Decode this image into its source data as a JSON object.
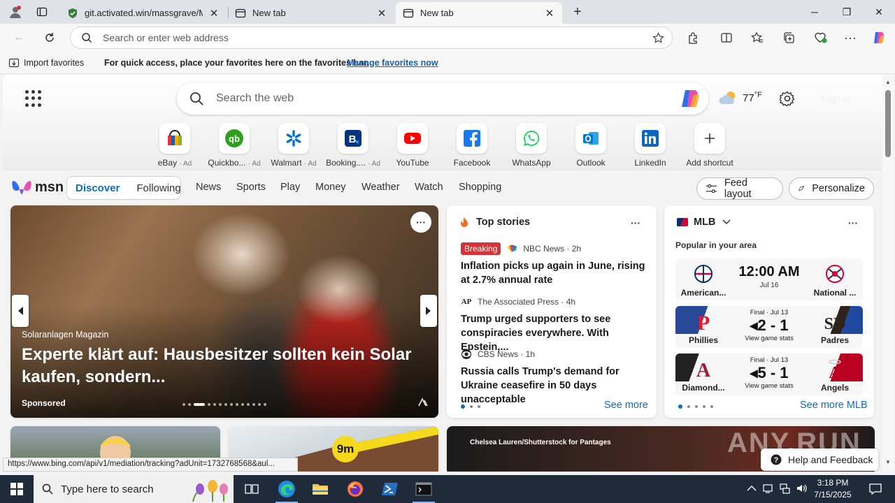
{
  "browser": {
    "tabs": [
      {
        "title": "git.activated.win/massgrave/Micr",
        "active": false
      },
      {
        "title": "New tab",
        "active": false
      },
      {
        "title": "New tab",
        "active": true
      }
    ],
    "address_placeholder": "Search or enter web address",
    "favorites_bar": {
      "import_label": "Import favorites",
      "message": "For quick access, place your favorites here on the favorites bar.",
      "manage_link": "Manage favorites now"
    },
    "status_url": "https://www.bing.com/api/v1/mediation/tracking?adUnit=1732768568&aul..."
  },
  "newtab": {
    "search_placeholder": "Search the web",
    "weather": {
      "temp": "77",
      "unit": "°F"
    },
    "signin_label": "Sign in",
    "shortcuts": [
      {
        "label": "eBay",
        "ad": "· Ad",
        "icon": "ebay-icon",
        "color": "#e53238"
      },
      {
        "label": "Quickbo...",
        "ad": "· Ad",
        "icon": "quickbooks-icon",
        "color": "#2ca01c"
      },
      {
        "label": "Walmart",
        "ad": "· Ad",
        "icon": "walmart-icon",
        "color": "#0071ce"
      },
      {
        "label": "Booking....",
        "ad": "· Ad",
        "icon": "booking-icon",
        "color": "#003580"
      },
      {
        "label": "YouTube",
        "ad": "",
        "icon": "youtube-icon",
        "color": "#ff0000"
      },
      {
        "label": "Facebook",
        "ad": "",
        "icon": "facebook-icon",
        "color": "#1877f2"
      },
      {
        "label": "WhatsApp",
        "ad": "",
        "icon": "whatsapp-icon",
        "color": "#25d366"
      },
      {
        "label": "Outlook",
        "ad": "",
        "icon": "outlook-icon",
        "color": "#0078d4"
      },
      {
        "label": "LinkedIn",
        "ad": "",
        "icon": "linkedin-icon",
        "color": "#0a66c2"
      },
      {
        "label": "Add shortcut",
        "ad": "",
        "icon": "plus-icon",
        "color": "#333333"
      }
    ]
  },
  "msn": {
    "logo_text": "msn",
    "feed_tabs": [
      "Discover",
      "Following"
    ],
    "nav": [
      "News",
      "Sports",
      "Play",
      "Money",
      "Weather",
      "Watch",
      "Shopping"
    ],
    "feed_layout_label": "Feed layout",
    "personalize_label": "Personalize",
    "hero": {
      "source": "Solaranlagen Magazin",
      "title": "Experte klärt auf: Hausbesitzer sollten kein Solar kaufen, sondern...",
      "sponsored": "Sponsored"
    },
    "top_stories": {
      "title": "Top stories",
      "items": [
        {
          "badge": "Breaking",
          "source": "NBC News · 2h",
          "headline": "Inflation picks up again in June, rising at 2.7% annual rate"
        },
        {
          "badge": "",
          "source": "The Associated Press · 4h",
          "headline": "Trump urged supporters to see conspiracies everywhere. With Epstein,..."
        },
        {
          "badge": "",
          "source": "CBS News · 1h",
          "headline": "Russia calls Trump's demand for Ukraine ceasefire in 50 days unacceptable"
        }
      ],
      "see_more": "See more"
    },
    "mlb": {
      "title": "MLB",
      "subtitle": "Popular in your area",
      "games": [
        {
          "home": "American...",
          "away": "National ...",
          "time": "12:00 AM",
          "date": "Jul 16",
          "status": "",
          "score": "",
          "stats": ""
        },
        {
          "home": "Phillies",
          "away": "Padres",
          "time": "",
          "date": "",
          "status": "Final · Jul 13",
          "score": "2 - 1",
          "stats": "View game stats"
        },
        {
          "home": "Diamond...",
          "away": "Angels",
          "time": "",
          "date": "",
          "status": "Final · Jul 13",
          "score": "5 - 1",
          "stats": "View game stats"
        }
      ],
      "see_more": "See more MLB"
    },
    "card6_caption": "Chelsea Lauren/Shutterstock for Pantages",
    "card5_badge": "9m"
  },
  "overlay": {
    "watermark": "ANY.RUN",
    "help_label": "Help and Feedback"
  },
  "taskbar": {
    "search_placeholder": "Type here to search",
    "time": "3:18 PM",
    "date": "7/15/2025"
  }
}
